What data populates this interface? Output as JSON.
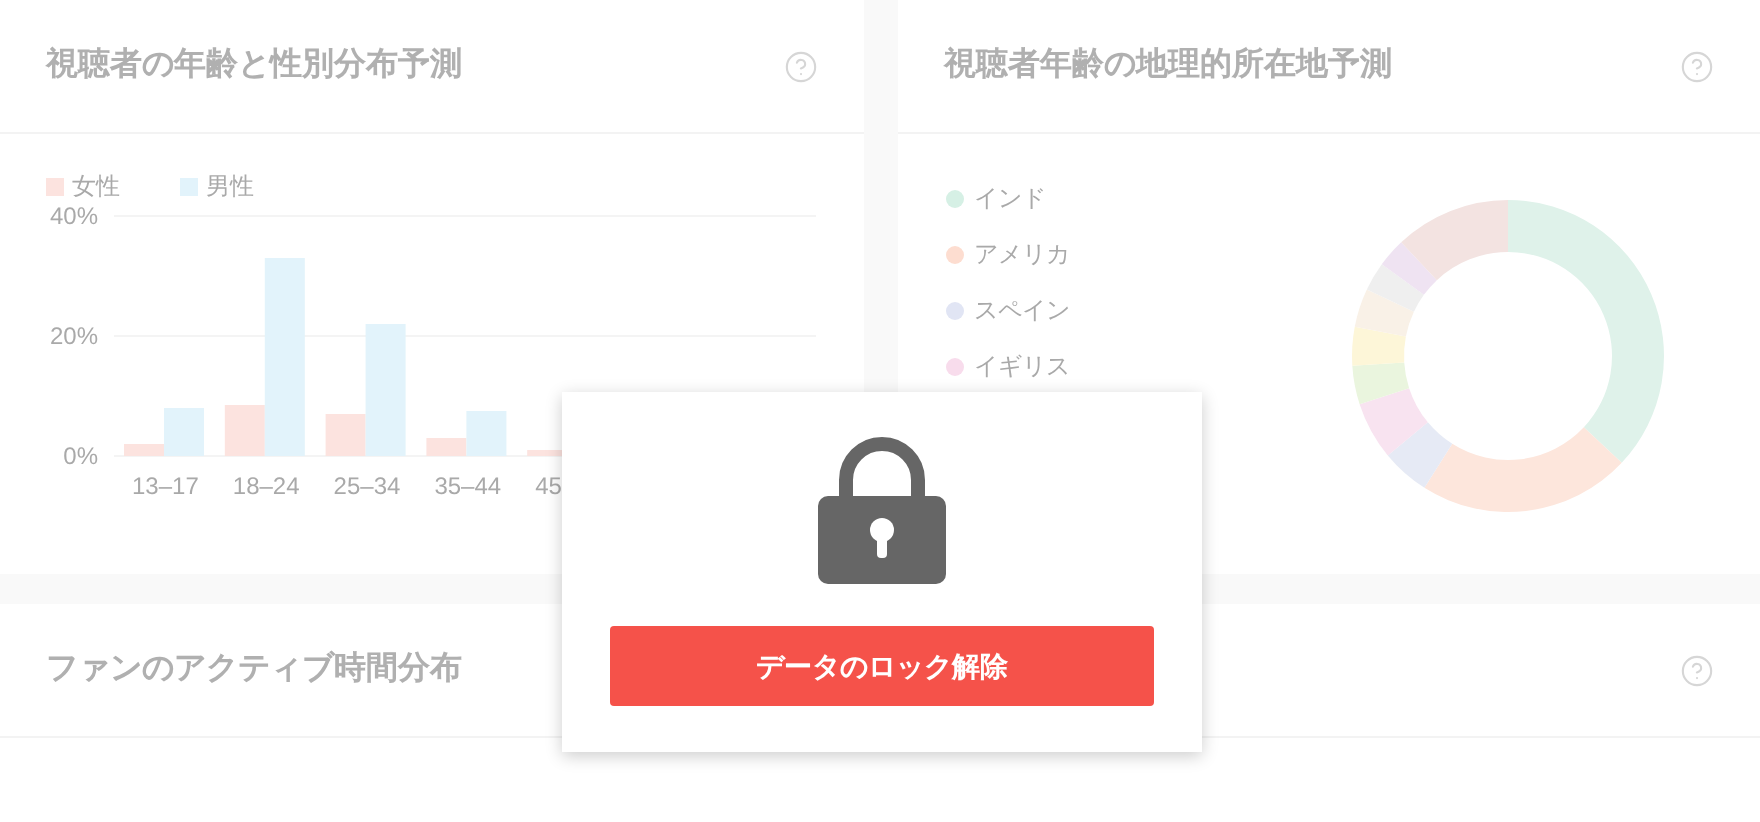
{
  "cards": [
    {
      "title": "視聴者の年齢と性別分布予測",
      "chart_data": {
        "type": "bar",
        "categories": [
          "13–17",
          "18–24",
          "25–34",
          "35–44",
          "45"
        ],
        "yticks": [
          {
            "value": 0,
            "label": "0%"
          },
          {
            "value": 20,
            "label": "20%"
          },
          {
            "value": 40,
            "label": "40%"
          }
        ],
        "ylim": [
          0,
          40
        ],
        "series": [
          {
            "name": "女性",
            "color": "#fce3df",
            "values": [
              2,
              8.5,
              7,
              3,
              1
            ]
          },
          {
            "name": "男性",
            "color": "#e2f3fb",
            "values": [
              8,
              33,
              22,
              7.5,
              null
            ]
          }
        ]
      }
    },
    {
      "title": "視聴者年齢の地理的所在地予測",
      "legend": [
        {
          "label": "インド",
          "color": "#d6f0e5"
        },
        {
          "label": "アメリカ",
          "color": "#fdddd0"
        },
        {
          "label": "スペイン",
          "color": "#e1e5f4"
        },
        {
          "label": "イギリス",
          "color": "#f8dcec"
        }
      ]
    },
    {
      "title": "ファンのアクティブ時間分布"
    }
  ],
  "modal": {
    "button": "データのロック解除"
  }
}
